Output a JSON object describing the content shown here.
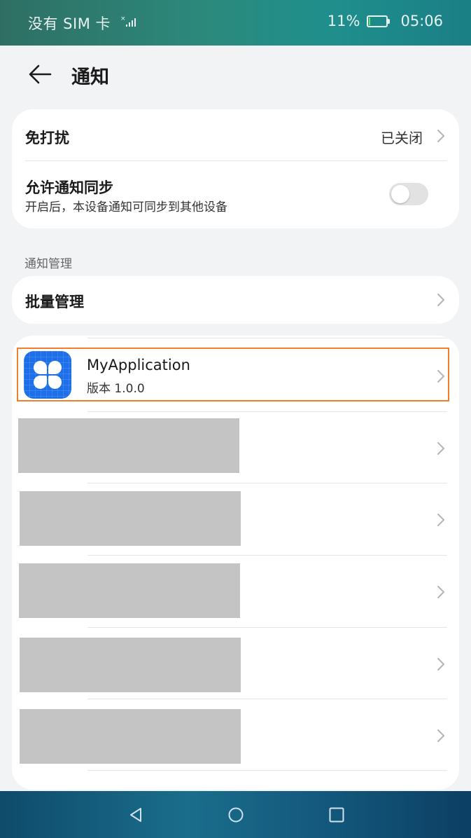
{
  "status_bar": {
    "sim_text": "没有 SIM 卡",
    "battery_text": "11%",
    "battery_level": 0.11,
    "time": "05:06"
  },
  "header": {
    "title": "通知"
  },
  "settings": {
    "do_not_disturb": {
      "label": "免打扰",
      "value": "已关闭"
    },
    "sync": {
      "label": "允许通知同步",
      "description": "开启后，本设备通知可同步到其他设备",
      "enabled": false
    }
  },
  "section": {
    "title": "通知管理"
  },
  "batch": {
    "label": "批量管理"
  },
  "apps": [
    {
      "name": "MyApplication",
      "version": "版本 1.0.0"
    }
  ],
  "colors": {
    "highlight": "#ef7f2b",
    "app_icon": "#1c6fe9"
  }
}
